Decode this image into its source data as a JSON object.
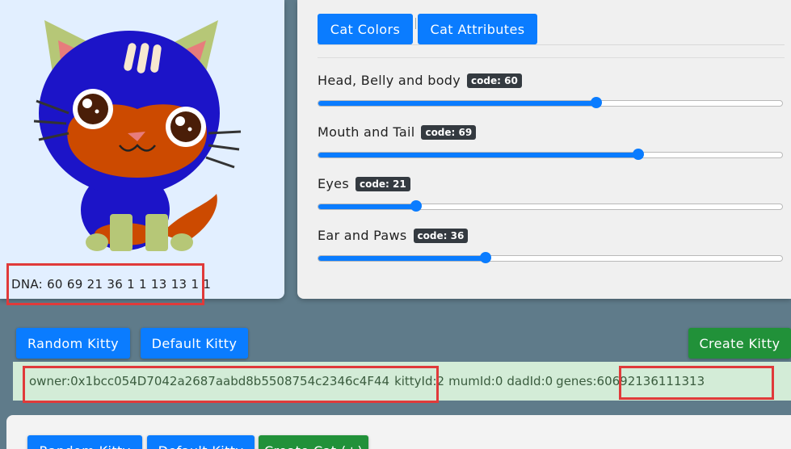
{
  "dna": {
    "text": "DNA: 60 69 21 36 1 1 13 13 1 1"
  },
  "tabs": {
    "colors": "Cat Colors",
    "attributes": "Cat Attributes"
  },
  "sliders": [
    {
      "label": "Head, Belly and body",
      "badge": "code: 60",
      "value": 60,
      "max": 100
    },
    {
      "label": "Mouth and Tail",
      "badge": "code: 69",
      "value": 69,
      "max": 100
    },
    {
      "label": "Eyes",
      "badge": "code: 21",
      "value": 21,
      "max": 100
    },
    {
      "label": "Ear and Paws",
      "badge": "code: 36",
      "value": 36,
      "max": 100
    }
  ],
  "actions": {
    "random": "Random Kitty",
    "default": "Default Kitty",
    "create": "Create Kitty"
  },
  "info": {
    "owner": "owner:0x1bcc054D7042a2687aabd8b5508754c2346c4F44",
    "kittyId": "kittyId:2",
    "mumId": "mumId:0",
    "dadId": "dadId:0",
    "genes": "genes:60692136111313"
  },
  "bottom": {
    "random": "Random Kitty",
    "default": "Default Kitty",
    "create": "Create Cat (+)"
  },
  "colors": {
    "head": "#1c14c8",
    "mouth": "#cc4a00",
    "eyes": "#4a1e08",
    "ears": "#b6c777",
    "accent": "#0a7cff",
    "success": "#219139",
    "highlight": "#e03a3a"
  }
}
